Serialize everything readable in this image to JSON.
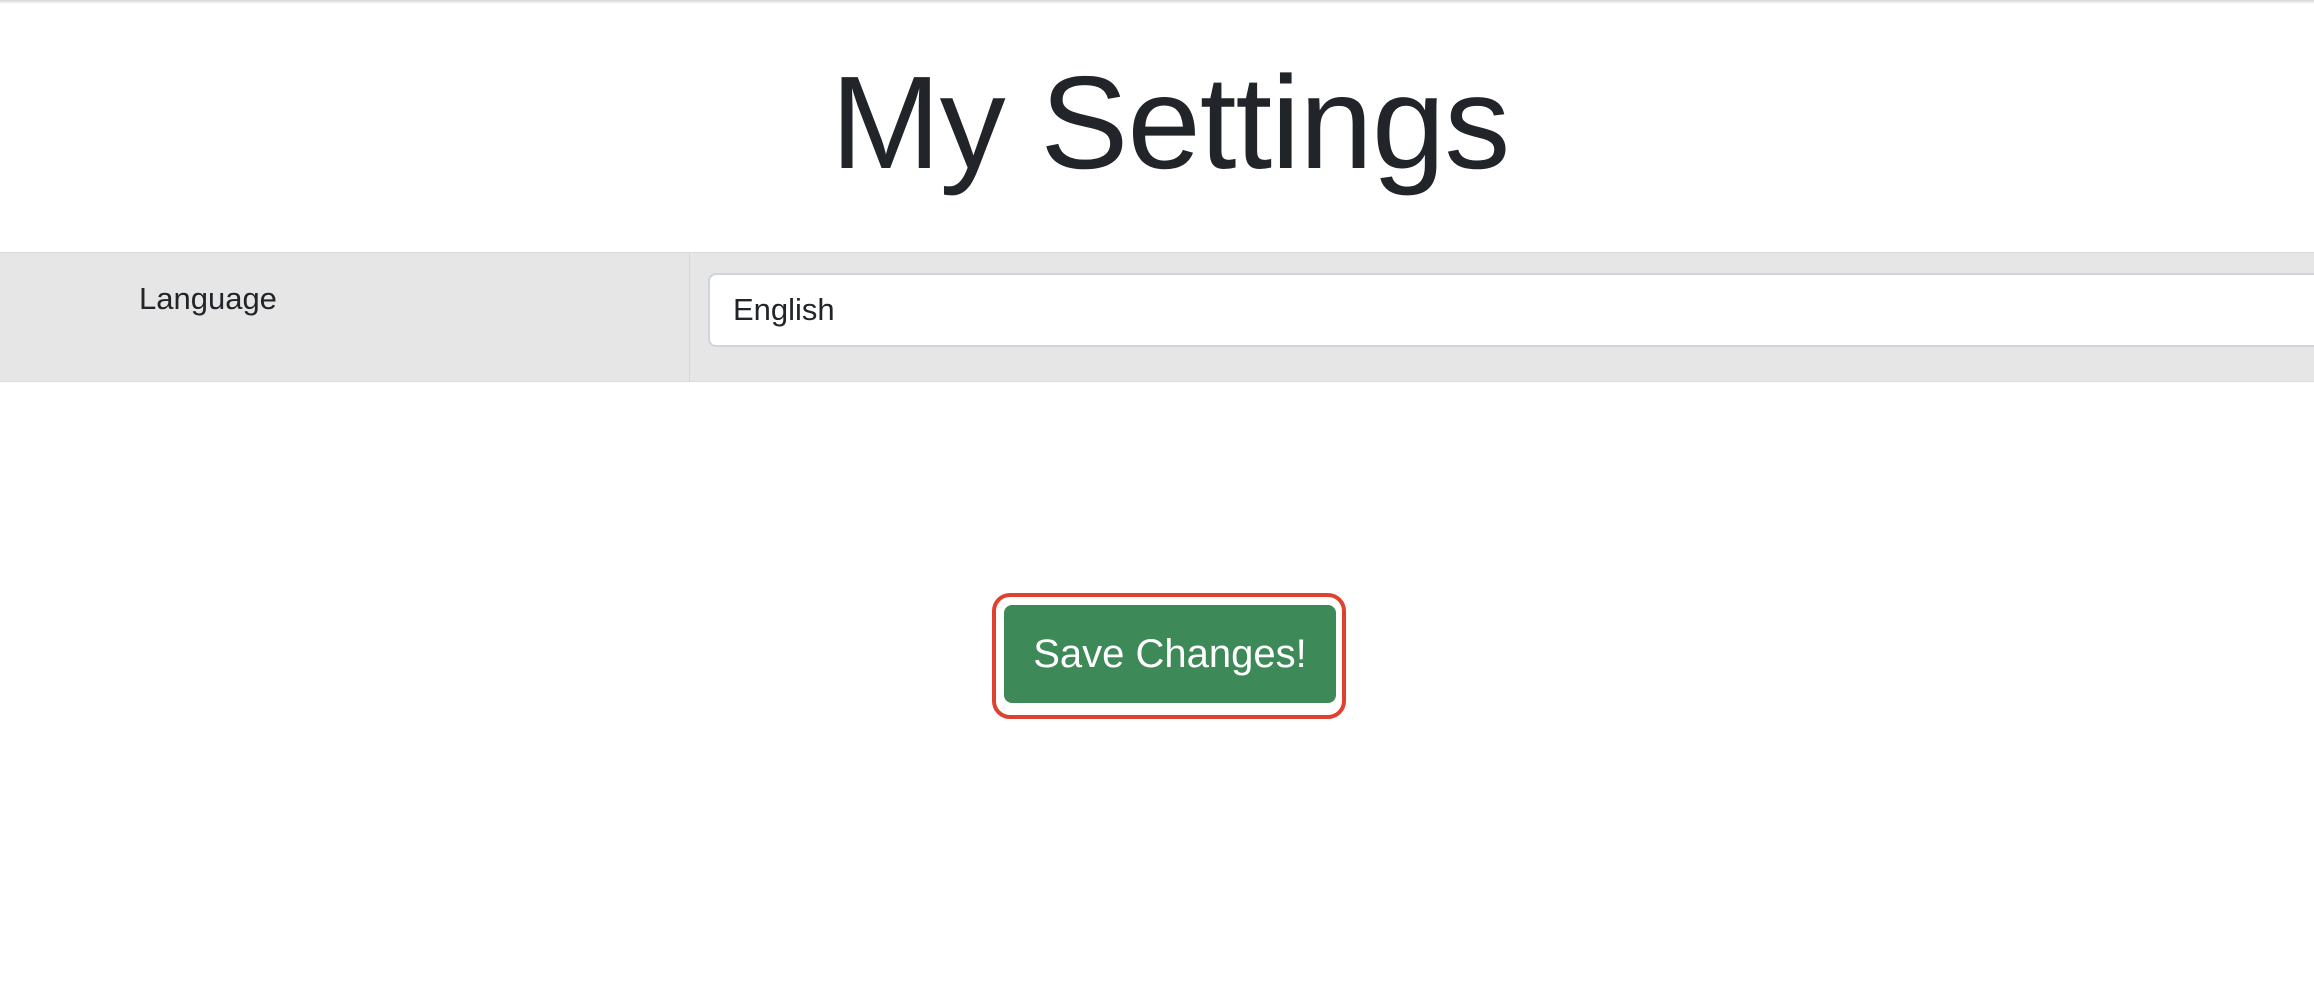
{
  "page": {
    "title": "My Settings"
  },
  "settings": {
    "language": {
      "label": "Language",
      "value": "English"
    }
  },
  "actions": {
    "save_label": "Save Changes!"
  },
  "colors": {
    "button_bg": "#3d8a58",
    "highlight_border": "#e0412f",
    "row_bg": "#e6e6e6"
  }
}
